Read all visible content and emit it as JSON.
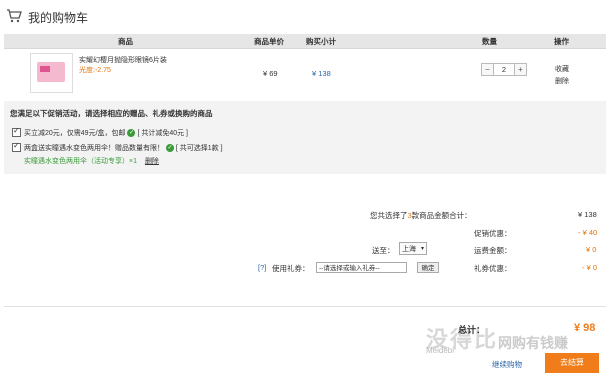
{
  "header": {
    "title": "我的购物车",
    "icon": "cart-icon"
  },
  "table": {
    "columns": [
      "商品",
      "商品单价",
      "购买小计",
      "数量",
      "操作"
    ]
  },
  "item": {
    "name": "实耀幻樱月抛隐形眼镜6片装",
    "promo": "光度:-2.75",
    "unit_price": "¥ 69",
    "subtotal": "¥ 138",
    "quantity": "2",
    "qty_minus": "−",
    "qty_plus": "+",
    "op_fav": "收藏",
    "op_delete": "删除"
  },
  "promotions": {
    "title": "您满足以下促销活动，请选择相应的赠品、礼券或换购的商品",
    "promo1_text": "买立减20元，仅需49元/盒，包邮",
    "promo1_badge": "[ 共计减免40元 ]",
    "promo2_text": "两盒送实瞳遇水变色两用伞！赠品数量有限！",
    "promo2_badge": "[ 共可选择1款 ]",
    "gift_text": "实瞳遇水变色两用伞（活动专享）×1",
    "gift_delete": "删除"
  },
  "summary": {
    "count_label_pre": "您共选择了",
    "count": "3",
    "count_label_post": "款商品金额合计：",
    "total_goods": "¥ 138",
    "discount_label": "促销优惠：",
    "discount": "- ¥ 40",
    "shipping_to_label": "送至：",
    "region": "上海",
    "shipping_label": "运费金额：",
    "shipping": "¥ 0",
    "coupon_help": "[?]",
    "coupon_label": "使用礼券：",
    "coupon_placeholder": "--请选择或输入礼券--",
    "confirm_label": "确定",
    "coupon_discount_label": "礼券优惠：",
    "coupon_discount": "- ¥ 0",
    "grand_total_label": "总计：",
    "grand_total": "¥ 98",
    "continue_label": "继续购物",
    "checkout_label": "去结算"
  },
  "watermark": {
    "text1": "没得比",
    "text2": "Meidebi",
    "text3": "网购有钱赚"
  },
  "colors": {
    "accent": "#f07d1a",
    "link": "#2a65a8",
    "green": "#3a9b3a"
  }
}
